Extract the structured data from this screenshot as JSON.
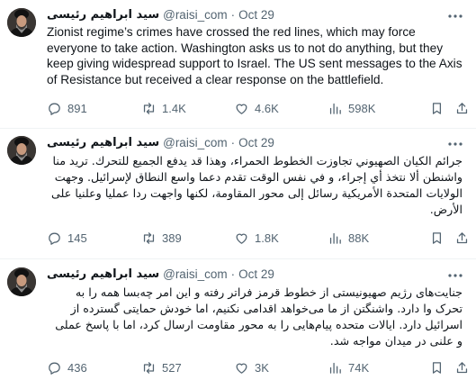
{
  "tweets": [
    {
      "name": "سید ابراهیم رئیسی",
      "handle": "@raisi_com",
      "dot": "·",
      "date": "Oct 29",
      "text": "Zionist regime’s crimes have crossed the red lines, which may force everyone to take action. Washington asks us to not do anything, but they keep giving widespread support to Israel. The US sent messages to the Axis of Resistance but received a clear response on the battlefield.",
      "replies": "891",
      "reposts": "1.4K",
      "likes": "4.6K",
      "views": "598K"
    },
    {
      "name": "سید ابراهیم رئیسی",
      "handle": "@raisi_com",
      "dot": "·",
      "date": "Oct 29",
      "text": "جرائم الكيان الصهيوني تجاوزت الخطوط الحمراء، وهذا قد يدفع الجميع للتحرك. تريد منا واشنطن ألا نتخذ أي إجراء، و في نفس الوقت تقدم دعما واسع النطاق لإسرائيل. وجهت الولايات المتحدة الأمريكية رسائل إلى محور المقاومة، لكنها واجهت ردا عمليا وعلنيا على الأرض.",
      "replies": "145",
      "reposts": "389",
      "likes": "1.8K",
      "views": "88K"
    },
    {
      "name": "سید ابراهیم رئیسی",
      "handle": "@raisi_com",
      "dot": "·",
      "date": "Oct 29",
      "text": "جنایت‌های رژیم صهیونیستی از خطوط قرمز فراتر رفته و این امر چه‌بسا همه را به تحرک وا دارد. واشنگتن از ما می‌خواهد اقدامی نکنیم، اما خودش حمایتی گسترده از اسرائیل دارد. ایالات متحده پیام‌هایی را به محور مقاومت ارسال کرد، اما با پاسخ عملی و علنی در میدان مواجه شد.",
      "replies": "436",
      "reposts": "527",
      "likes": "3K",
      "views": "74K"
    }
  ],
  "icons": {
    "avatar": "avatar-photo",
    "more": "more-icon",
    "reply": "reply-icon",
    "repost": "repost-icon",
    "like": "like-icon",
    "views": "views-icon",
    "bookmark": "bookmark-icon",
    "share": "share-icon"
  },
  "colors": {
    "text": "#0f1419",
    "secondary": "#536471",
    "divider": "#eff3f4"
  }
}
